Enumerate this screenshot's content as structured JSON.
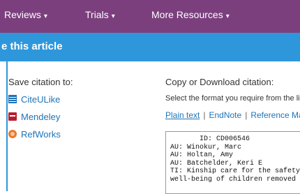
{
  "topnav": {
    "items": [
      {
        "label": "Reviews",
        "caret": "▾"
      },
      {
        "label": "Trials",
        "caret": "▾"
      },
      {
        "label": "More Resources",
        "caret": "▾"
      }
    ]
  },
  "banner": {
    "title": "e this article"
  },
  "save_citation": {
    "heading": "Save citation to:",
    "items": [
      {
        "label": "CiteULike",
        "icon": "citeulike-icon"
      },
      {
        "label": "Mendeley",
        "icon": "mendeley-icon"
      },
      {
        "label": "RefWorks",
        "icon": "refworks-icon"
      }
    ]
  },
  "copy_download": {
    "heading": "Copy or Download citation:",
    "instructions": "Select the format you require from the list",
    "formats": [
      "Plain text",
      "EndNote",
      "Reference Mana"
    ],
    "separator": "|",
    "citation_lines": [
      "       ID: CD006546",
      "AU: Winokur, Marc",
      "AU: Holtan, Amy",
      "AU: Batchelder, Keri E",
      "TI: Kinship care for the safety",
      "well-being of children removed"
    ]
  },
  "colors": {
    "nav": "#7b3f7e",
    "banner": "#2e97db",
    "link": "#1f73b7"
  }
}
